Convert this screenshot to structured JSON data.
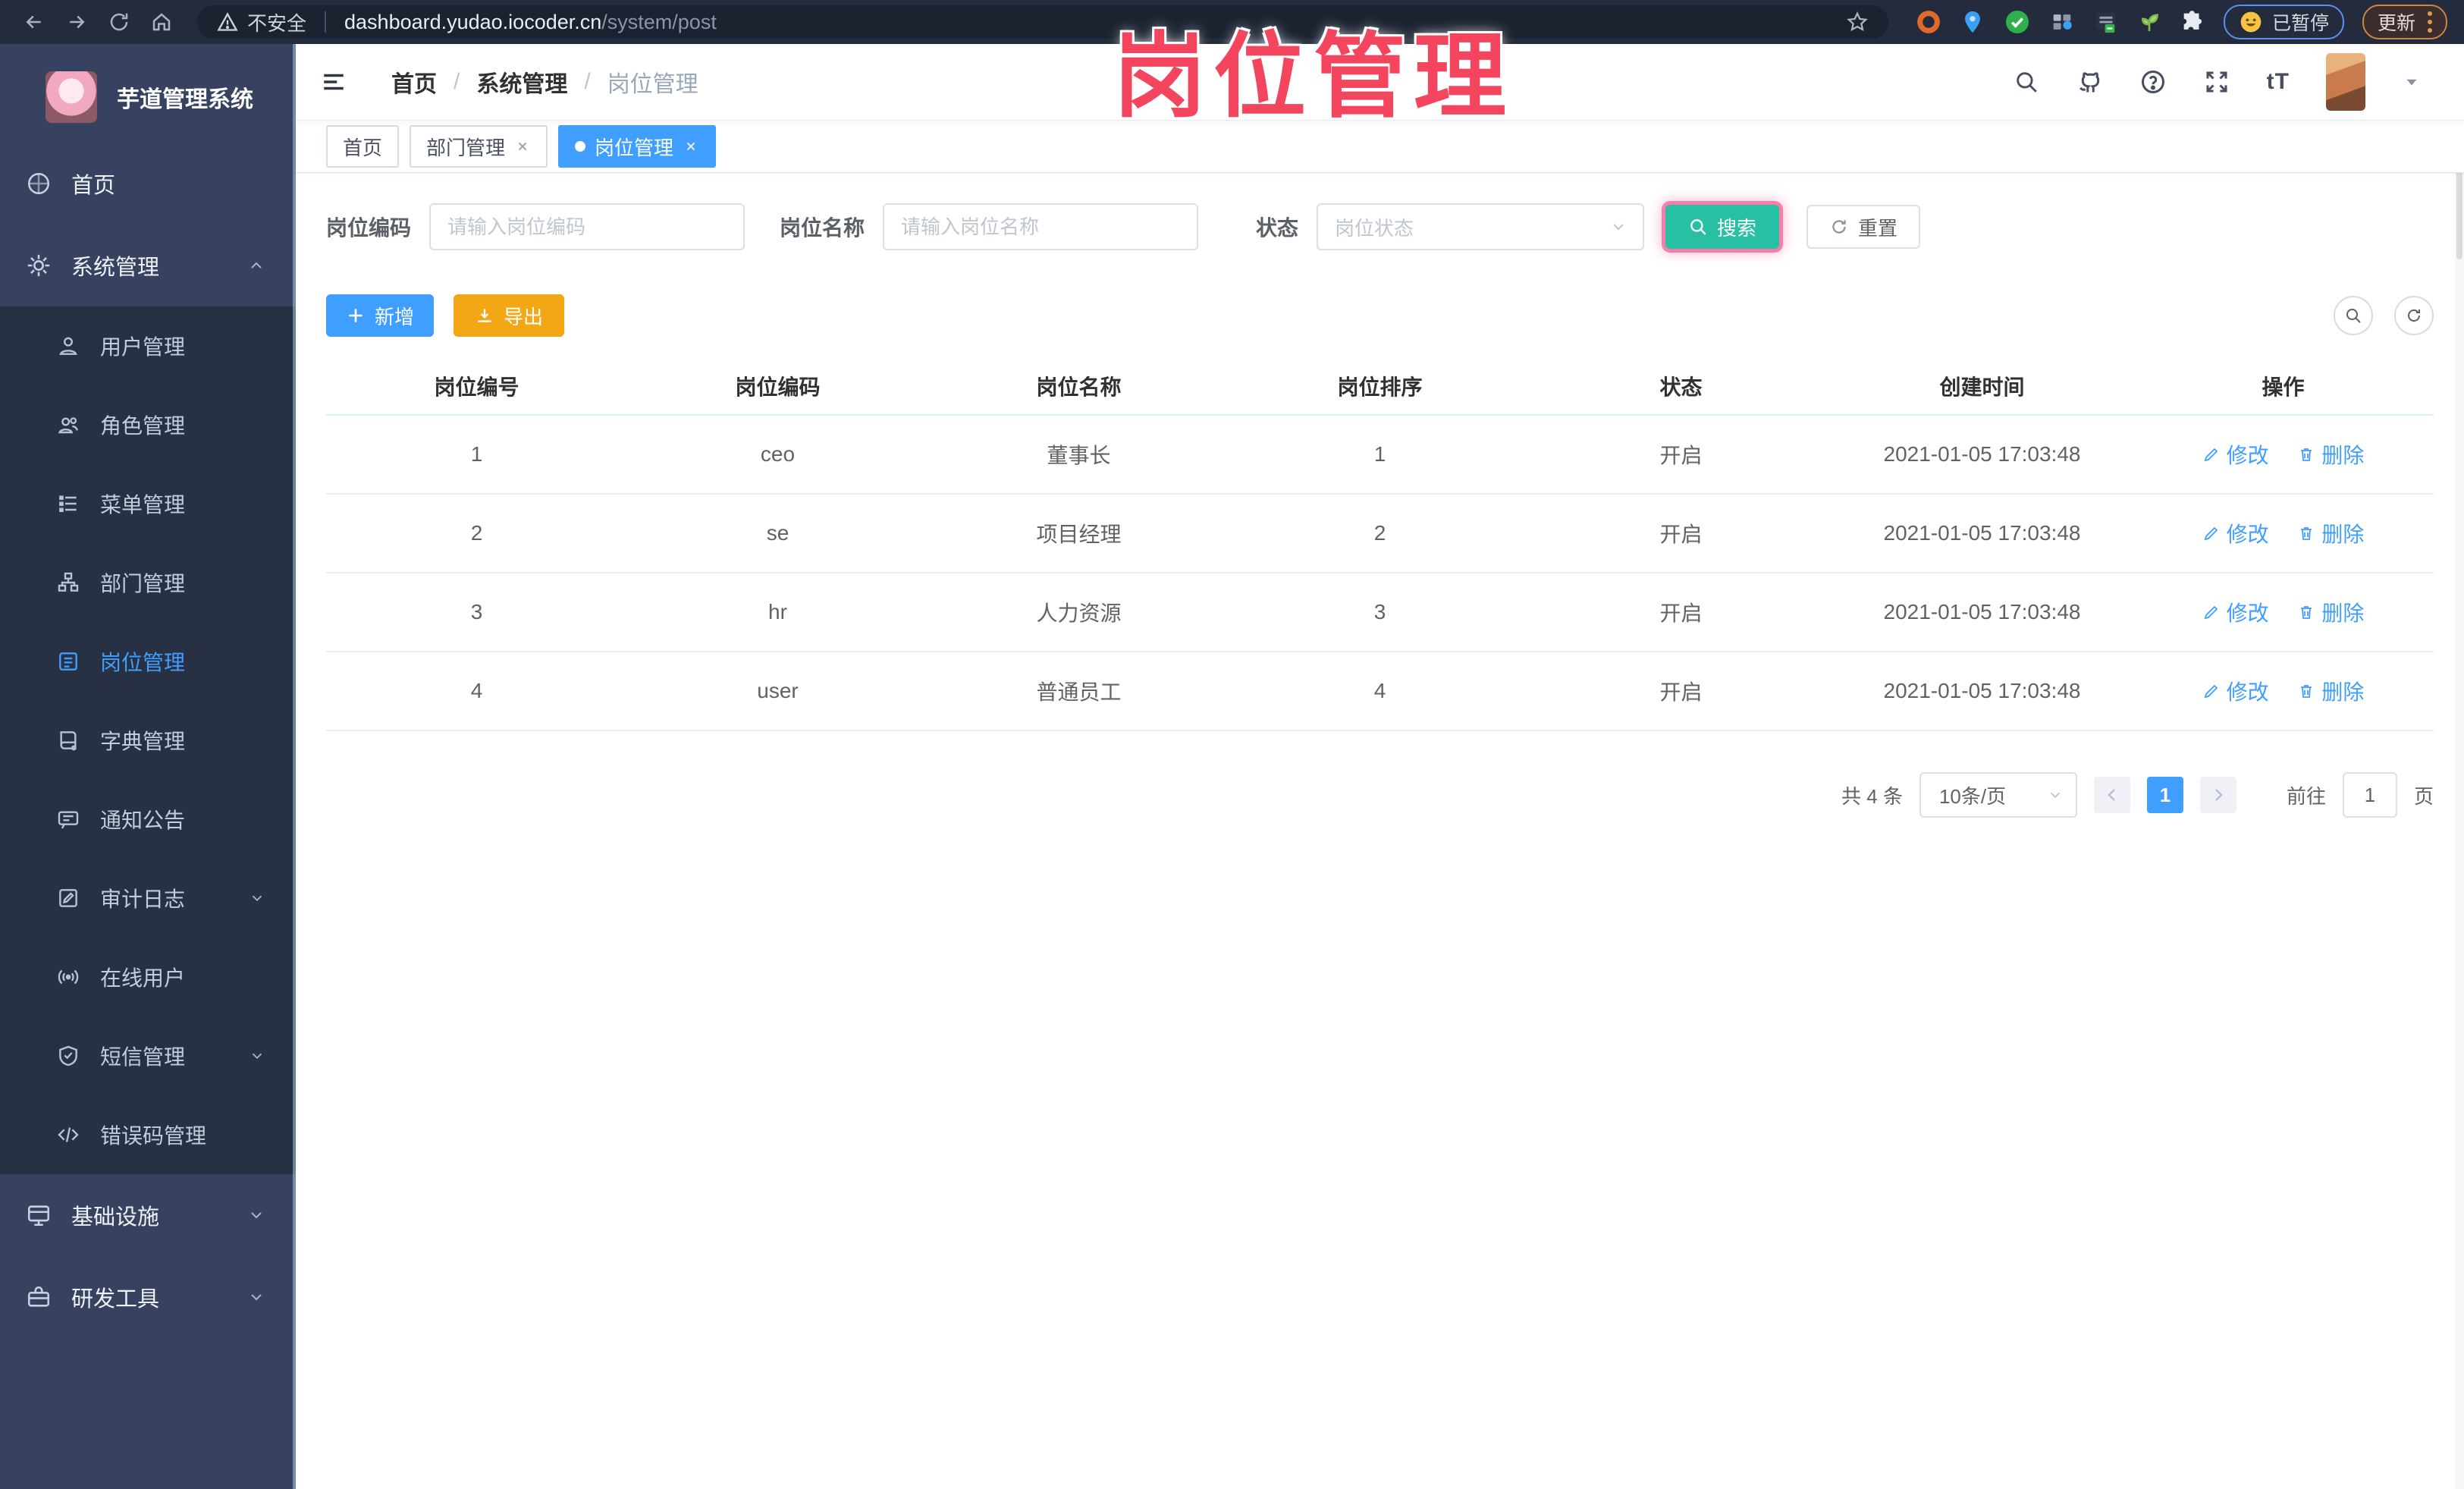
{
  "browser": {
    "security_label": "不安全",
    "url_domain": "dashboard.yudao.iocoder.cn",
    "url_path": "/system/post",
    "paused_label": "已暂停",
    "update_label": "更新"
  },
  "annotation": {
    "title": "岗位管理",
    "color": "#f3455e"
  },
  "sidebar": {
    "app_title": "芋道管理系统",
    "home_label": "首页",
    "system_label": "系统管理",
    "system_children": [
      "用户管理",
      "角色管理",
      "菜单管理",
      "部门管理",
      "岗位管理",
      "字典管理",
      "通知公告",
      "审计日志",
      "在线用户",
      "短信管理",
      "错误码管理"
    ],
    "infra_label": "基础设施",
    "tools_label": "研发工具"
  },
  "breadcrumb": {
    "items": [
      "首页",
      "系统管理",
      "岗位管理"
    ],
    "separator": "/"
  },
  "tabs": [
    "首页",
    "部门管理",
    "岗位管理"
  ],
  "filters": {
    "code_label": "岗位编码",
    "code_placeholder": "请输入岗位编码",
    "name_label": "岗位名称",
    "name_placeholder": "请输入岗位名称",
    "status_label": "状态",
    "status_placeholder": "岗位状态",
    "search_label": "搜索",
    "reset_label": "重置"
  },
  "toolbar": {
    "add_label": "新增",
    "export_label": "导出"
  },
  "table": {
    "columns": [
      "岗位编号",
      "岗位编码",
      "岗位名称",
      "岗位排序",
      "状态",
      "创建时间",
      "操作"
    ],
    "rows": [
      [
        "1",
        "ceo",
        "董事长",
        "1",
        "开启",
        "2021-01-05 17:03:48"
      ],
      [
        "2",
        "se",
        "项目经理",
        "2",
        "开启",
        "2021-01-05 17:03:48"
      ],
      [
        "3",
        "hr",
        "人力资源",
        "3",
        "开启",
        "2021-01-05 17:03:48"
      ],
      [
        "4",
        "user",
        "普通员工",
        "4",
        "开启",
        "2021-01-05 17:03:48"
      ]
    ],
    "edit_label": "修改",
    "delete_label": "删除"
  },
  "pagination": {
    "total_label": "共 4 条",
    "page_size": "10条/页",
    "current_page": "1",
    "goto_label": "前往",
    "goto_value": "1",
    "page_unit": "页"
  },
  "header_icons": {
    "font_size_icon_text": "tT"
  },
  "colors": {
    "accent": "#409eff",
    "search_button": "#27c0a2",
    "export_button": "#f3a714",
    "annotation": "#f3455e",
    "sidebar_bg": "#36425f",
    "submenu_bg": "#273143"
  }
}
